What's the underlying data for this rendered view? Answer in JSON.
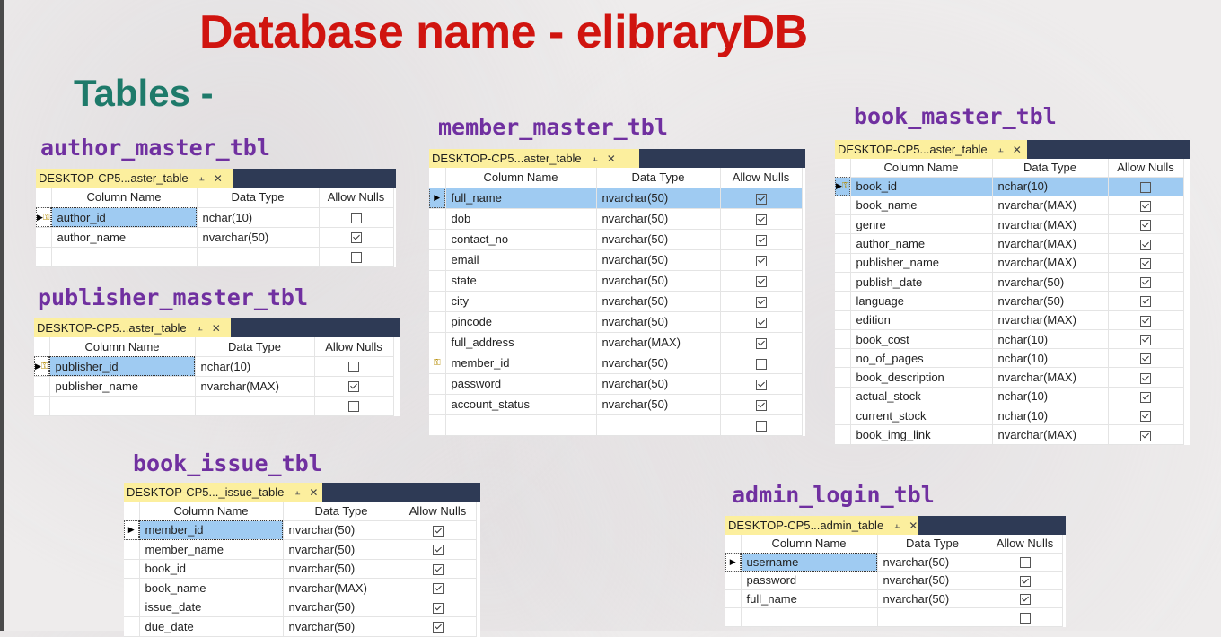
{
  "header": {
    "title": "Database name - elibraryDB",
    "subtitle": "Tables -"
  },
  "columns": {
    "name": "Column Name",
    "type": "Data Type",
    "nulls": "Allow Nulls"
  },
  "icons": {
    "pin": "pin-icon",
    "close": "close-icon",
    "key": "primary-key-icon",
    "row_pointer": "row-pointer-icon"
  },
  "colors": {
    "title": "#d0140f",
    "subtitle": "#1e7a6a",
    "table_title": "#7030a0",
    "tab": "#fcef9e",
    "tabbar": "#2e3a55",
    "selection": "#9fcbf2"
  },
  "tables": [
    {
      "id": "author",
      "title": "author_master_tbl",
      "tab": "DESKTOP-CP5...aster_table",
      "empty_row": true,
      "rows": [
        {
          "name": "author_id",
          "type": "nchar(10)",
          "nulls": false,
          "key": true,
          "pointer": true,
          "selected": "cell"
        },
        {
          "name": "author_name",
          "type": "nvarchar(50)",
          "nulls": true
        }
      ]
    },
    {
      "id": "publisher",
      "title": "publisher_master_tbl",
      "tab": "DESKTOP-CP5...aster_table",
      "empty_row": true,
      "rows": [
        {
          "name": "publisher_id",
          "type": "nchar(10)",
          "nulls": false,
          "key": true,
          "pointer": true,
          "selected": "cell"
        },
        {
          "name": "publisher_name",
          "type": "nvarchar(MAX)",
          "nulls": true
        }
      ]
    },
    {
      "id": "member",
      "title": "member_master_tbl",
      "tab": "DESKTOP-CP5...aster_table",
      "empty_row": true,
      "rows": [
        {
          "name": "full_name",
          "type": "nvarchar(50)",
          "nulls": true,
          "pointer": true,
          "selected": "row"
        },
        {
          "name": "dob",
          "type": "nvarchar(50)",
          "nulls": true
        },
        {
          "name": "contact_no",
          "type": "nvarchar(50)",
          "nulls": true
        },
        {
          "name": "email",
          "type": "nvarchar(50)",
          "nulls": true
        },
        {
          "name": "state",
          "type": "nvarchar(50)",
          "nulls": true
        },
        {
          "name": "city",
          "type": "nvarchar(50)",
          "nulls": true
        },
        {
          "name": "pincode",
          "type": "nvarchar(50)",
          "nulls": true
        },
        {
          "name": "full_address",
          "type": "nvarchar(MAX)",
          "nulls": true
        },
        {
          "name": "member_id",
          "type": "nvarchar(50)",
          "nulls": false,
          "key": true
        },
        {
          "name": "password",
          "type": "nvarchar(50)",
          "nulls": true
        },
        {
          "name": "account_status",
          "type": "nvarchar(50)",
          "nulls": true
        }
      ]
    },
    {
      "id": "book",
      "title": "book_master_tbl",
      "tab": "DESKTOP-CP5...aster_table",
      "empty_row": false,
      "rows": [
        {
          "name": "book_id",
          "type": "nchar(10)",
          "nulls": false,
          "key": true,
          "pointer": true,
          "selected": "row"
        },
        {
          "name": "book_name",
          "type": "nvarchar(MAX)",
          "nulls": true
        },
        {
          "name": "genre",
          "type": "nvarchar(MAX)",
          "nulls": true
        },
        {
          "name": "author_name",
          "type": "nvarchar(MAX)",
          "nulls": true
        },
        {
          "name": "publisher_name",
          "type": "nvarchar(MAX)",
          "nulls": true
        },
        {
          "name": "publish_date",
          "type": "nvarchar(50)",
          "nulls": true
        },
        {
          "name": "language",
          "type": "nvarchar(50)",
          "nulls": true
        },
        {
          "name": "edition",
          "type": "nvarchar(MAX)",
          "nulls": true
        },
        {
          "name": "book_cost",
          "type": "nchar(10)",
          "nulls": true
        },
        {
          "name": "no_of_pages",
          "type": "nchar(10)",
          "nulls": true
        },
        {
          "name": "book_description",
          "type": "nvarchar(MAX)",
          "nulls": true
        },
        {
          "name": "actual_stock",
          "type": "nchar(10)",
          "nulls": true
        },
        {
          "name": "current_stock",
          "type": "nchar(10)",
          "nulls": true
        },
        {
          "name": "book_img_link",
          "type": "nvarchar(MAX)",
          "nulls": true
        }
      ]
    },
    {
      "id": "issue",
      "title": "book_issue_tbl",
      "tab": "DESKTOP-CP5..._issue_table",
      "empty_row": false,
      "rows": [
        {
          "name": "member_id",
          "type": "nvarchar(50)",
          "nulls": true,
          "pointer": true,
          "selected": "cell"
        },
        {
          "name": "member_name",
          "type": "nvarchar(50)",
          "nulls": true
        },
        {
          "name": "book_id",
          "type": "nvarchar(50)",
          "nulls": true
        },
        {
          "name": "book_name",
          "type": "nvarchar(MAX)",
          "nulls": true
        },
        {
          "name": "issue_date",
          "type": "nvarchar(50)",
          "nulls": true
        },
        {
          "name": "due_date",
          "type": "nvarchar(50)",
          "nulls": true
        }
      ]
    },
    {
      "id": "admin",
      "title": "admin_login_tbl",
      "tab": "DESKTOP-CP5...admin_table",
      "empty_row": true,
      "rows": [
        {
          "name": "username",
          "type": "nvarchar(50)",
          "nulls": false,
          "pointer": true,
          "selected": "cell"
        },
        {
          "name": "password",
          "type": "nvarchar(50)",
          "nulls": true
        },
        {
          "name": "full_name",
          "type": "nvarchar(50)",
          "nulls": true
        }
      ]
    }
  ]
}
